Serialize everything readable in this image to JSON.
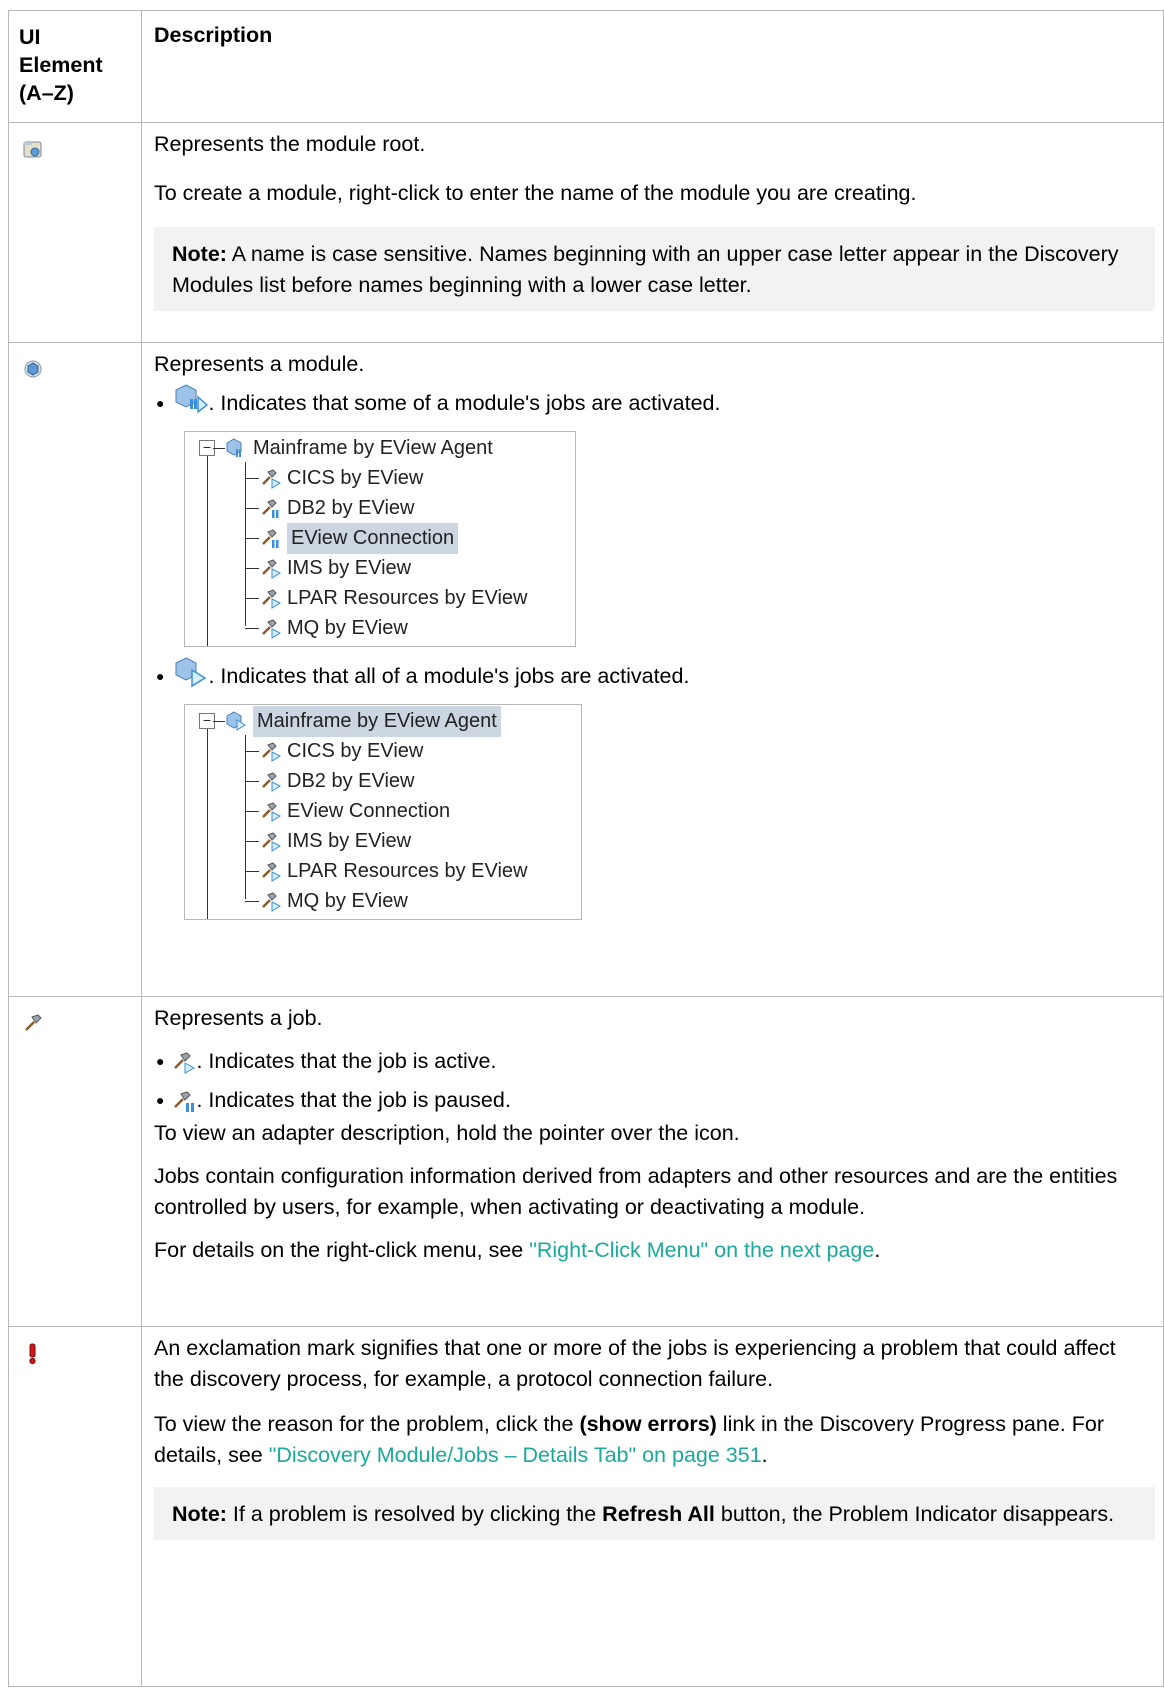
{
  "header": {
    "col1": "UI Element (A–Z)",
    "col1_lines": [
      "UI",
      "Element",
      "(A–Z)"
    ],
    "col2": "Description"
  },
  "rows": {
    "root": {
      "icon": "module-root-icon",
      "p1": "Represents the module root.",
      "p2": "To create a module, right-click to enter the name of the module you are creating.",
      "note_label": "Note:",
      "note_text": " A name is case sensitive. Names beginning with an upper case letter appear in the Discovery Modules list before names beginning with a lower case letter."
    },
    "module": {
      "icon": "module-icon",
      "p1": "Represents a module.",
      "bullet1": ". Indicates that some of a module's jobs are activated.",
      "bullet2": ". Indicates that all of a module's jobs are activated.",
      "tree1": {
        "root": "Mainframe by EView Agent",
        "items": [
          "CICS by EView",
          "DB2 by EView",
          "EView Connection",
          "IMS by EView",
          "LPAR Resources by EView",
          "MQ by EView"
        ],
        "selected": "EView Connection"
      },
      "tree2": {
        "root": "Mainframe by EView Agent",
        "items": [
          "CICS by EView",
          "DB2 by EView",
          "EView Connection",
          "IMS by EView",
          "LPAR Resources by EView",
          "MQ by EView"
        ],
        "selected": "Mainframe by EView Agent"
      }
    },
    "job": {
      "icon": "job-hammer-icon",
      "p1": "Represents a job.",
      "bullet1": ". Indicates that the job is active.",
      "bullet2": ". Indicates that the job is paused.",
      "p2": "To view an adapter description, hold the pointer over the icon.",
      "p3": "Jobs contain configuration information derived from adapters and other resources and are the entities controlled by users, for example, when activating or deactivating a module.",
      "p4_pre": "For details on the right-click menu, see ",
      "p4_link": "\"Right-Click Menu\" on the next page",
      "p4_post": "."
    },
    "problem": {
      "icon": "exclamation-icon",
      "p1": "An exclamation mark signifies that one or more of the jobs is experiencing a problem that could affect the discovery process, for example, a protocol connection failure.",
      "p2_pre": "To view the reason for the problem, click the ",
      "p2_bold": "(show errors)",
      "p2_mid": " link in the Discovery Progress pane. For details, see ",
      "p2_link": "\"Discovery Module/Jobs – Details Tab\" on page 351",
      "p2_post": ".",
      "note_label": "Note:",
      "note_pre": " If a problem is resolved by clicking the ",
      "note_bold": "Refresh All",
      "note_post": " button, the Problem Indicator disappears."
    }
  },
  "colors": {
    "link": "#1aa99a",
    "note_bg": "#f2f2f2",
    "border": "#b7b7b7",
    "selection": "#ccd6e0"
  }
}
